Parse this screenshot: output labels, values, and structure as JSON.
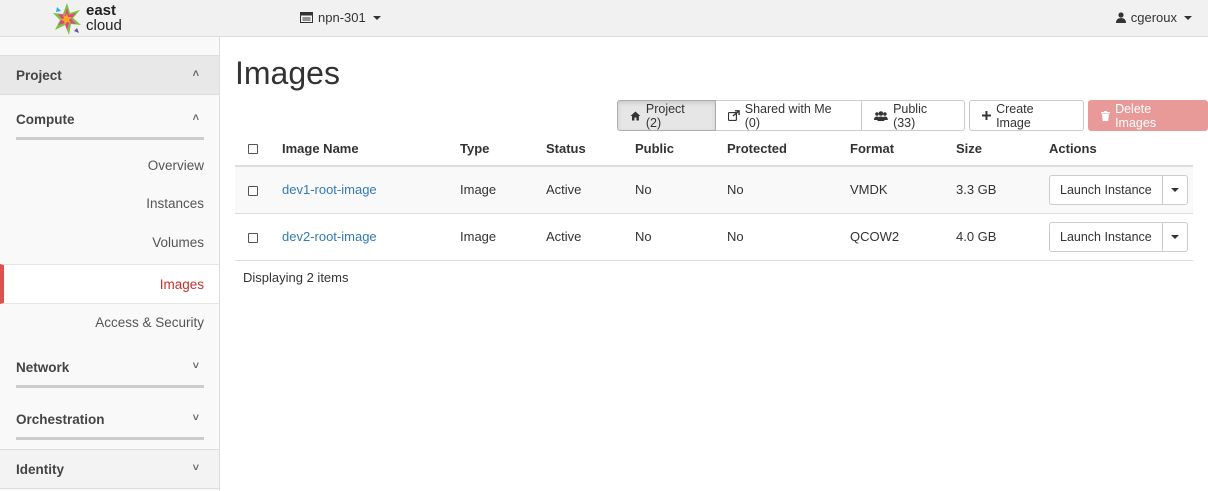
{
  "topbar": {
    "logo_line1": "east",
    "logo_line2": "cloud",
    "project": "npn-301",
    "user": "cgeroux"
  },
  "sidebar": {
    "project_label": "Project",
    "compute_label": "Compute",
    "items": [
      {
        "label": "Overview"
      },
      {
        "label": "Instances"
      },
      {
        "label": "Volumes"
      },
      {
        "label": "Images"
      },
      {
        "label": "Access & Security"
      }
    ],
    "network_label": "Network",
    "orchestration_label": "Orchestration",
    "identity_label": "Identity"
  },
  "page": {
    "title": "Images"
  },
  "toolbar": {
    "filter_project": "Project (2)",
    "filter_shared": "Shared with Me (0)",
    "filter_public": "Public (33)",
    "create": "Create Image",
    "delete": "Delete Images"
  },
  "table": {
    "headers": [
      "Image Name",
      "Type",
      "Status",
      "Public",
      "Protected",
      "Format",
      "Size",
      "Actions"
    ],
    "rows": [
      {
        "name": "dev1-root-image",
        "type": "Image",
        "status": "Active",
        "public": "No",
        "protected": "No",
        "format": "VMDK",
        "size": "3.3 GB",
        "action": "Launch Instance"
      },
      {
        "name": "dev2-root-image",
        "type": "Image",
        "status": "Active",
        "public": "No",
        "protected": "No",
        "format": "QCOW2",
        "size": "4.0 GB",
        "action": "Launch Instance"
      }
    ],
    "footer": "Displaying 2 items"
  },
  "colors": {
    "active_accent": "#d9534f",
    "link": "#337ab7",
    "delete_button": "#e89a99"
  }
}
